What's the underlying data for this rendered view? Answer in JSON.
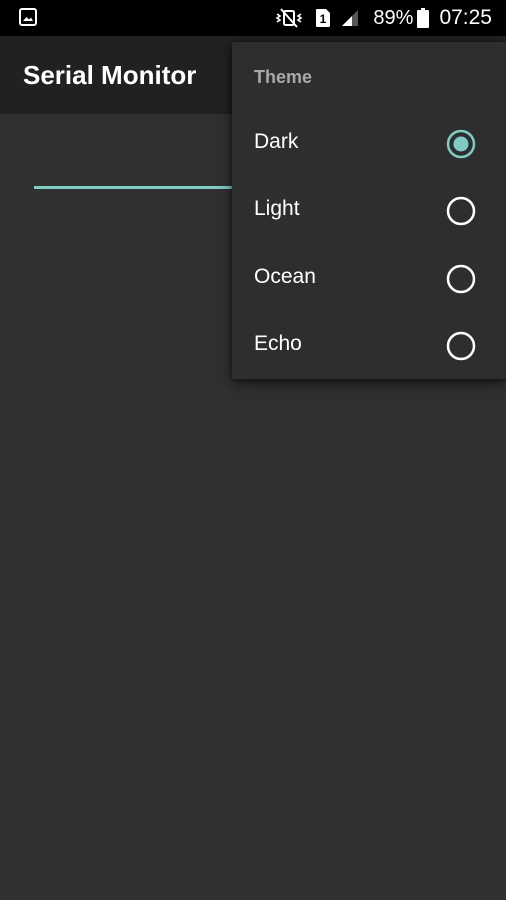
{
  "status_bar": {
    "battery": "89%",
    "time": "07:25",
    "icons": [
      "gallery-icon",
      "mute-vibrate-icon",
      "sim-1-icon",
      "signal-icon",
      "battery-icon"
    ]
  },
  "app_bar": {
    "title": "Serial Monitor"
  },
  "theme_menu": {
    "header": "Theme",
    "options": [
      {
        "label": "Dark",
        "selected": true
      },
      {
        "label": "Light",
        "selected": false
      },
      {
        "label": "Ocean",
        "selected": false
      },
      {
        "label": "Echo",
        "selected": false
      }
    ]
  },
  "colors": {
    "background": "#303030",
    "app_bar": "#212121",
    "status_bar": "#000000",
    "menu_background": "#2e2e2e",
    "accent": "#80cbc4",
    "menu_header_text": "#a9a9a9"
  }
}
